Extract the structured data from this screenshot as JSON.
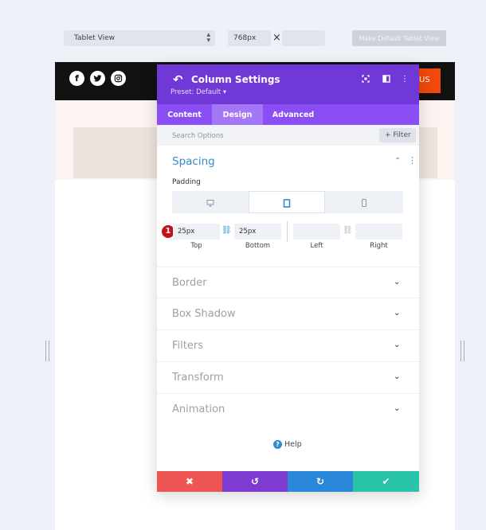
{
  "toolbar": {
    "view_select": "Tablet View",
    "width_value": "768px",
    "times_symbol": "×",
    "height_value": "",
    "make_default_label": "Make Default Tablet View"
  },
  "preview": {
    "cta_label": "US",
    "social": [
      "facebook-icon",
      "twitter-icon",
      "instagram-icon"
    ]
  },
  "modal": {
    "title": "Column Settings",
    "preset": "Preset: Default ▾",
    "tabs": [
      {
        "label": "Content",
        "active": false
      },
      {
        "label": "Design",
        "active": true
      },
      {
        "label": "Advanced",
        "active": false
      }
    ],
    "search_placeholder": "Search Options",
    "filter_label": "+ Filter",
    "spacing": {
      "title": "Spacing",
      "padding_label": "Padding",
      "devices": [
        "desktop-icon",
        "tablet-icon",
        "phone-icon"
      ],
      "active_device": "tablet",
      "step_badge": "1",
      "top_value": "25px",
      "bottom_value": "25px",
      "left_value": "",
      "right_value": "",
      "captions": {
        "top": "Top",
        "bottom": "Bottom",
        "left": "Left",
        "right": "Right"
      }
    },
    "sections": [
      "Border",
      "Box Shadow",
      "Filters",
      "Transform",
      "Animation"
    ],
    "help_label": "Help",
    "footer": {
      "cancel_color": "#ef5555",
      "undo_color": "#7e3bd0",
      "redo_color": "#2b87da",
      "save_color": "#29c4a9"
    }
  },
  "colors": {
    "header_purple": "#7138d8",
    "tabs_purple": "#8b4ef5",
    "accent_blue": "#2e8fcc",
    "cta_orange": "#f0480d",
    "badge_red": "#c3111c"
  }
}
